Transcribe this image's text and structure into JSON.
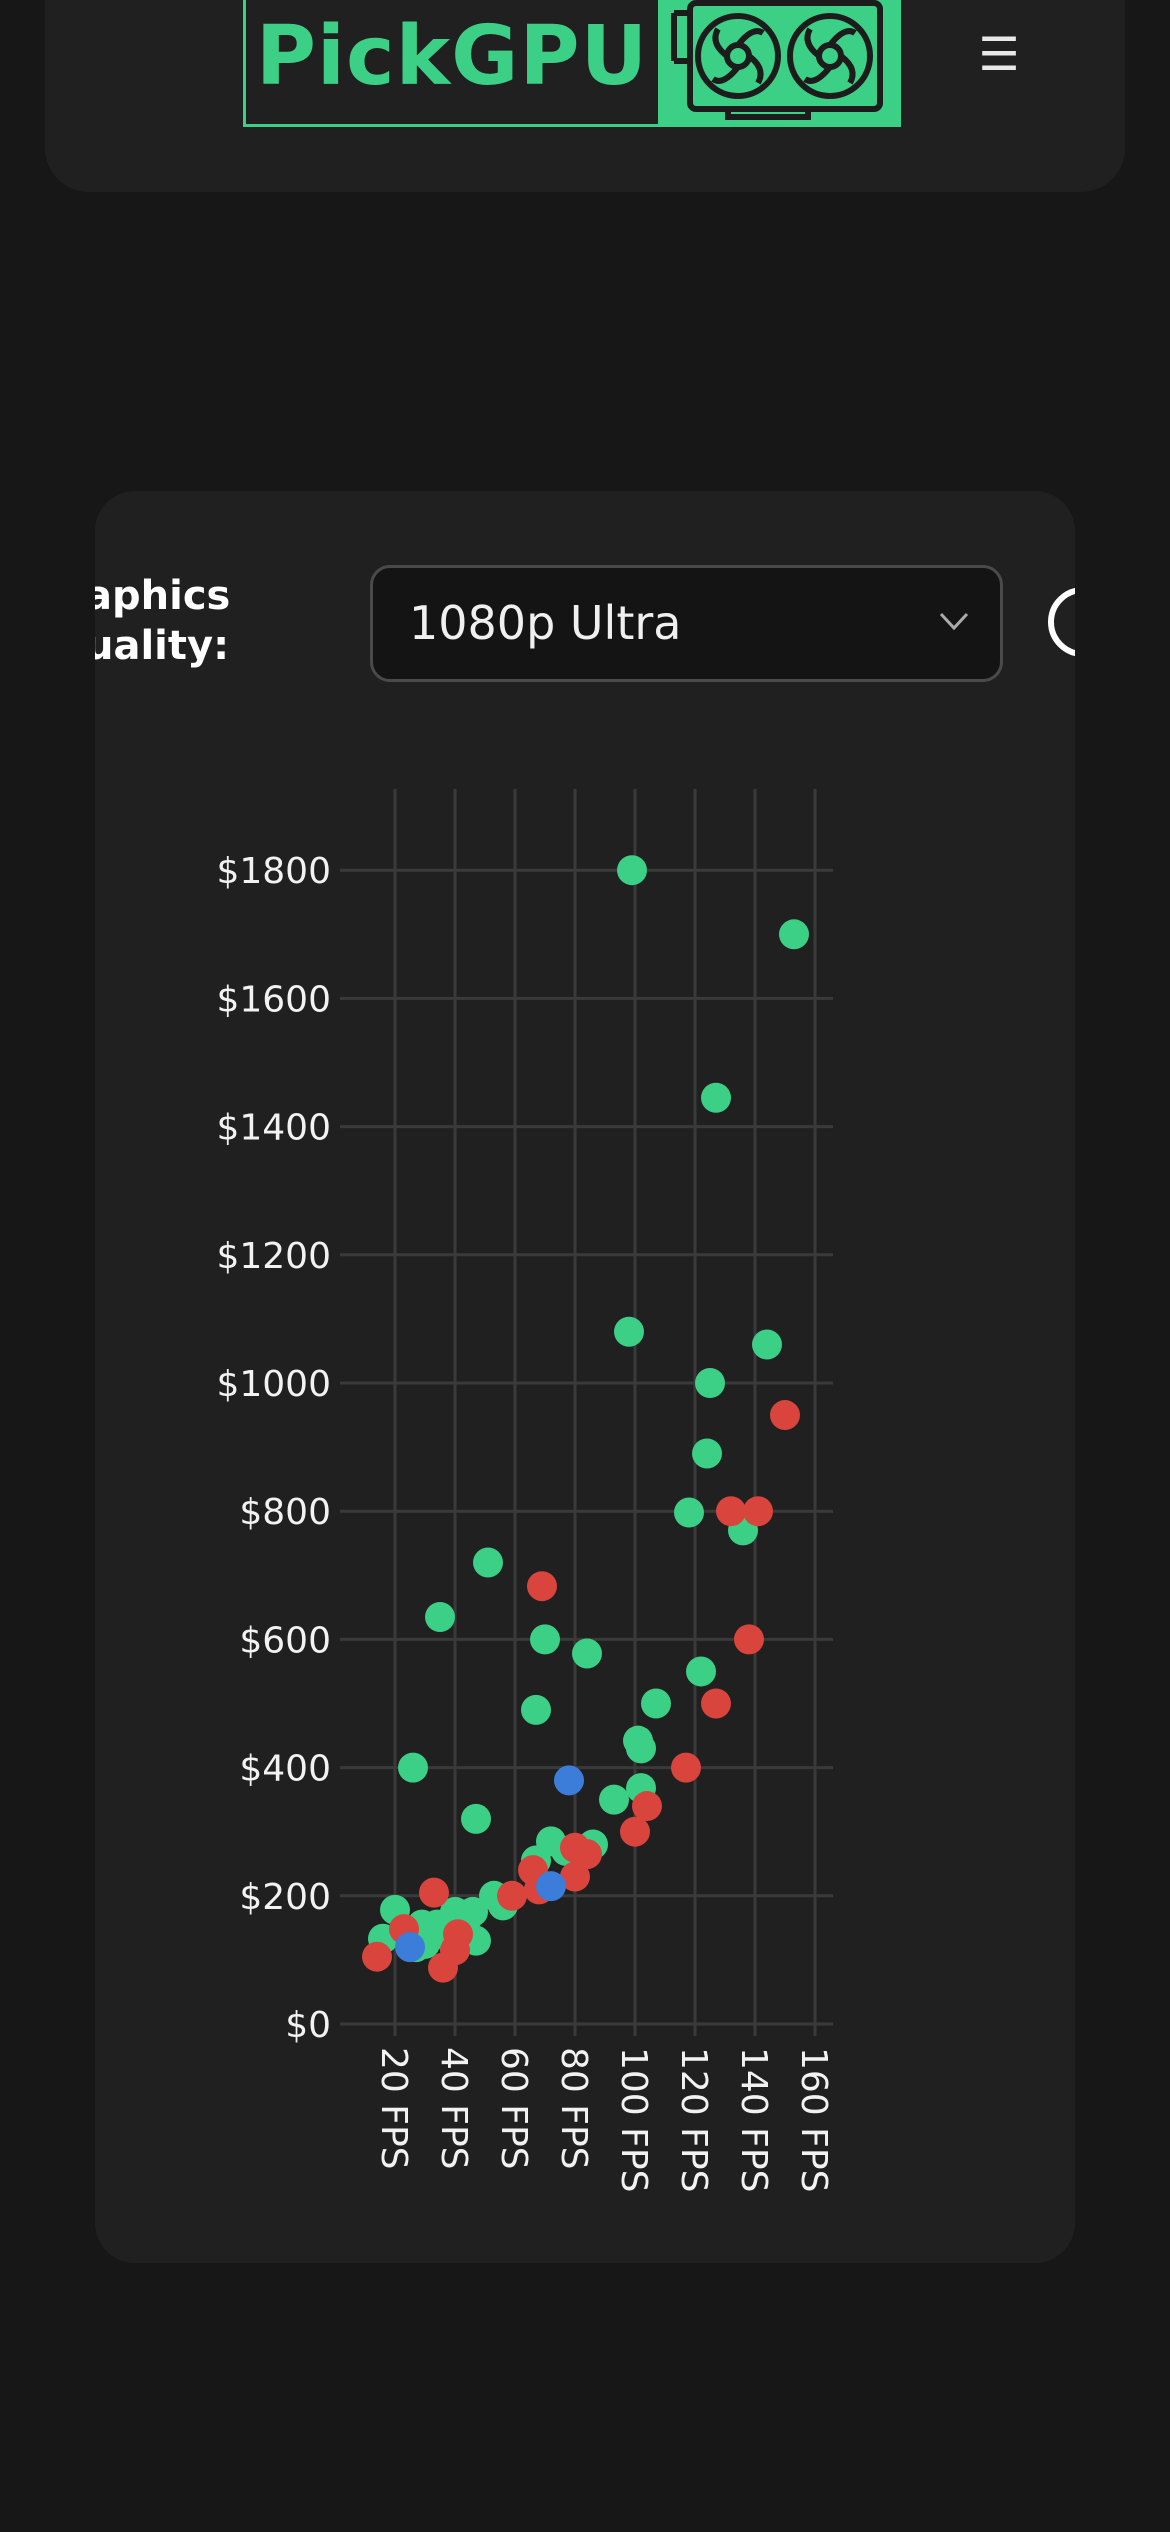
{
  "header": {
    "logo_text": "PickGPU",
    "logo_icon": "graphics-card-icon",
    "menu_icon": "hamburger-menu-icon"
  },
  "filters": {
    "quality_label_line1": "aphics",
    "quality_label_line2": "uality:",
    "quality_value": "1080p Ultra"
  },
  "colors": {
    "brand": "#3ccf86",
    "nvidia": "#3ccf86",
    "amd": "#d9443d",
    "intel": "#3b7dd8"
  },
  "chart_data": {
    "type": "scatter",
    "xlabel": "",
    "ylabel": "",
    "x_ticks": [
      20,
      40,
      60,
      80,
      100,
      120,
      140,
      160
    ],
    "x_tick_labels": [
      "20 FPS",
      "40 FPS",
      "60 FPS",
      "80 FPS",
      "100 FPS",
      "120 FPS",
      "140 FPS",
      "160 FPS"
    ],
    "y_ticks": [
      0,
      200,
      400,
      600,
      800,
      1000,
      1200,
      1400,
      1600,
      1800
    ],
    "y_tick_labels": [
      "$0",
      "$200",
      "$400",
      "$600",
      "$800",
      "$1000",
      "$1200",
      "$1400",
      "$1600",
      "$1800"
    ],
    "xlim": [
      20,
      160
    ],
    "ylim": [
      0,
      1800
    ],
    "grid": true,
    "series": [
      {
        "color": "#3ccf86",
        "points": [
          [
            99,
            1800
          ],
          [
            153,
            1700
          ],
          [
            127,
            1445
          ],
          [
            98,
            1080
          ],
          [
            144,
            1060
          ],
          [
            125,
            1000
          ],
          [
            124,
            890
          ],
          [
            118,
            798
          ],
          [
            136,
            770
          ],
          [
            51,
            720
          ],
          [
            35,
            635
          ],
          [
            70,
            600
          ],
          [
            84,
            578
          ],
          [
            67,
            490
          ],
          [
            107,
            500
          ],
          [
            122,
            550
          ],
          [
            26,
            400
          ],
          [
            101,
            442
          ],
          [
            102,
            430
          ],
          [
            47,
            320
          ],
          [
            93,
            350
          ],
          [
            102,
            368
          ],
          [
            72,
            285
          ],
          [
            77,
            270
          ],
          [
            86,
            280
          ],
          [
            67,
            255
          ],
          [
            53,
            200
          ],
          [
            56,
            185
          ],
          [
            20,
            178
          ],
          [
            16,
            133
          ],
          [
            29,
            155
          ],
          [
            34,
            155
          ],
          [
            40,
            175
          ],
          [
            46,
            175
          ],
          [
            44,
            165
          ],
          [
            47,
            130
          ],
          [
            39,
            130
          ],
          [
            30,
            125
          ],
          [
            27,
            120
          ]
        ]
      },
      {
        "color": "#d9443d",
        "points": [
          [
            150,
            950
          ],
          [
            132,
            800
          ],
          [
            141,
            800
          ],
          [
            69,
            683
          ],
          [
            138,
            600
          ],
          [
            127,
            500
          ],
          [
            117,
            400
          ],
          [
            104,
            340
          ],
          [
            100,
            300
          ],
          [
            80,
            275
          ],
          [
            84,
            265
          ],
          [
            66,
            240
          ],
          [
            80,
            230
          ],
          [
            33,
            205
          ],
          [
            68,
            210
          ],
          [
            59,
            200
          ],
          [
            41,
            140
          ],
          [
            23,
            148
          ],
          [
            14,
            105
          ],
          [
            40,
            115
          ],
          [
            36,
            88
          ]
        ]
      },
      {
        "color": "#3b7dd8",
        "points": [
          [
            78,
            380
          ],
          [
            72,
            215
          ],
          [
            25,
            120
          ]
        ]
      }
    ]
  }
}
